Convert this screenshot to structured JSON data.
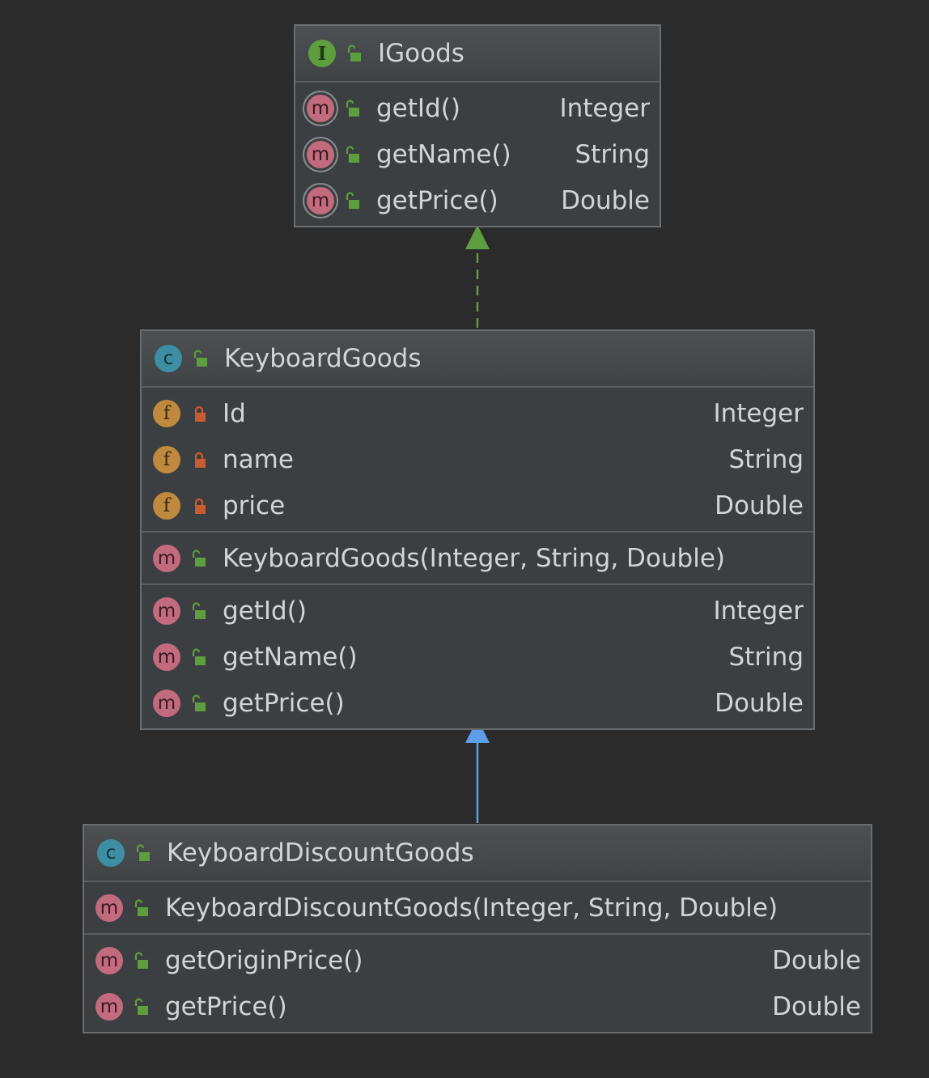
{
  "colors": {
    "background": "#2b2b2b",
    "box": "#3c3f41",
    "realization_arrow": "#5e9e3e",
    "inheritance_arrow": "#5c9fe8",
    "public_lock": "#5e9e3e",
    "private_lock": "#c75c30"
  },
  "classes": [
    {
      "id": "igoods",
      "kind": "interface",
      "kind_icon_letter": "I",
      "visibility_icon": "public-lock-open-icon",
      "title": "IGoods",
      "sections": [
        [
          {
            "kind_icon": "m",
            "abstract": true,
            "visibility_icon": "public-lock-open-icon",
            "name": "getId()",
            "type": "Integer"
          },
          {
            "kind_icon": "m",
            "abstract": true,
            "visibility_icon": "public-lock-open-icon",
            "name": "getName()",
            "type": "String"
          },
          {
            "kind_icon": "m",
            "abstract": true,
            "visibility_icon": "public-lock-open-icon",
            "name": "getPrice()",
            "type": "Double"
          }
        ]
      ]
    },
    {
      "id": "keyboardgoods",
      "kind": "class",
      "kind_icon_letter": "c",
      "visibility_icon": "public-lock-open-icon",
      "title": "KeyboardGoods",
      "sections": [
        [
          {
            "kind_icon": "f",
            "visibility_icon": "private-lock-icon",
            "name": "Id",
            "type": "Integer"
          },
          {
            "kind_icon": "f",
            "visibility_icon": "private-lock-icon",
            "name": "name",
            "type": "String"
          },
          {
            "kind_icon": "f",
            "visibility_icon": "private-lock-icon",
            "name": "price",
            "type": "Double"
          }
        ],
        [
          {
            "kind_icon": "m",
            "visibility_icon": "public-lock-open-icon",
            "name": "KeyboardGoods(Integer, String, Double)",
            "type": ""
          }
        ],
        [
          {
            "kind_icon": "m",
            "visibility_icon": "public-lock-open-icon",
            "name": "getId()",
            "type": "Integer"
          },
          {
            "kind_icon": "m",
            "visibility_icon": "public-lock-open-icon",
            "name": "getName()",
            "type": "String"
          },
          {
            "kind_icon": "m",
            "visibility_icon": "public-lock-open-icon",
            "name": "getPrice()",
            "type": "Double"
          }
        ]
      ]
    },
    {
      "id": "keyboarddiscountgoods",
      "kind": "class",
      "kind_icon_letter": "c",
      "visibility_icon": "public-lock-open-icon",
      "title": "KeyboardDiscountGoods",
      "sections": [
        [
          {
            "kind_icon": "m",
            "visibility_icon": "public-lock-open-icon",
            "name": "KeyboardDiscountGoods(Integer, String, Double)",
            "type": ""
          }
        ],
        [
          {
            "kind_icon": "m",
            "visibility_icon": "public-lock-open-icon",
            "name": "getOriginPrice()",
            "type": "Double"
          },
          {
            "kind_icon": "m",
            "visibility_icon": "public-lock-open-icon",
            "name": "getPrice()",
            "type": "Double"
          }
        ]
      ]
    }
  ],
  "relations": [
    {
      "from": "keyboardgoods",
      "to": "igoods",
      "type": "realization",
      "line": "dashed"
    },
    {
      "from": "keyboarddiscountgoods",
      "to": "keyboardgoods",
      "type": "generalization",
      "line": "solid"
    }
  ]
}
